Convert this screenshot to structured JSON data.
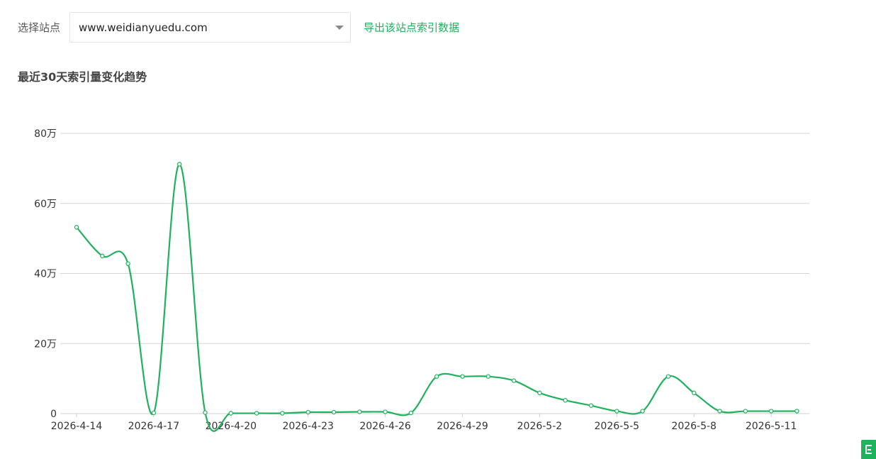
{
  "toolbar": {
    "site_label": "选择站点",
    "site_value": "www.weidianyuedu.com",
    "export_label": "导出该站点索引数据"
  },
  "section": {
    "title": "最近30天索引量变化趋势"
  },
  "colors": {
    "accent": "#1eb25c",
    "grid": "#d6d6d6",
    "axis_text": "#333333"
  },
  "corner_button": {
    "icon": "feedback-icon"
  },
  "chart_data": {
    "type": "line",
    "title": "",
    "xlabel": "",
    "ylabel": "",
    "ylim": [
      0,
      800000
    ],
    "y_ticks": [
      {
        "value": 0,
        "label": "0"
      },
      {
        "value": 200000,
        "label": "20万"
      },
      {
        "value": 400000,
        "label": "40万"
      },
      {
        "value": 600000,
        "label": "60万"
      },
      {
        "value": 800000,
        "label": "80万"
      }
    ],
    "x_tick_labels": [
      "2026-4-14",
      "2026-4-17",
      "2026-4-20",
      "2026-4-23",
      "2026-4-26",
      "2026-4-29",
      "2026-5-2",
      "2026-5-5",
      "2026-5-8",
      "2026-5-11"
    ],
    "grid": true,
    "smooth": true,
    "series": [
      {
        "x": [
          "2026-4-14",
          "2026-4-15",
          "2026-4-16",
          "2026-4-17",
          "2026-4-18",
          "2026-4-19",
          "2026-4-20",
          "2026-4-21",
          "2026-4-22",
          "2026-4-23",
          "2026-4-24",
          "2026-4-25",
          "2026-4-26",
          "2026-4-27",
          "2026-4-28",
          "2026-4-29",
          "2026-4-30",
          "2026-5-1",
          "2026-5-2",
          "2026-5-3",
          "2026-5-4",
          "2026-5-5",
          "2026-5-6",
          "2026-5-7",
          "2026-5-8",
          "2026-5-9",
          "2026-5-10",
          "2026-5-11",
          "2026-5-12"
        ],
        "values": [
          532000,
          450000,
          428000,
          2000,
          712000,
          3000,
          1000,
          1000,
          1000,
          4000,
          4000,
          5000,
          5000,
          2000,
          106000,
          106000,
          106000,
          94000,
          59000,
          38000,
          23000,
          7000,
          7000,
          106000,
          59000,
          7000,
          7000,
          7000,
          7000
        ]
      }
    ]
  }
}
